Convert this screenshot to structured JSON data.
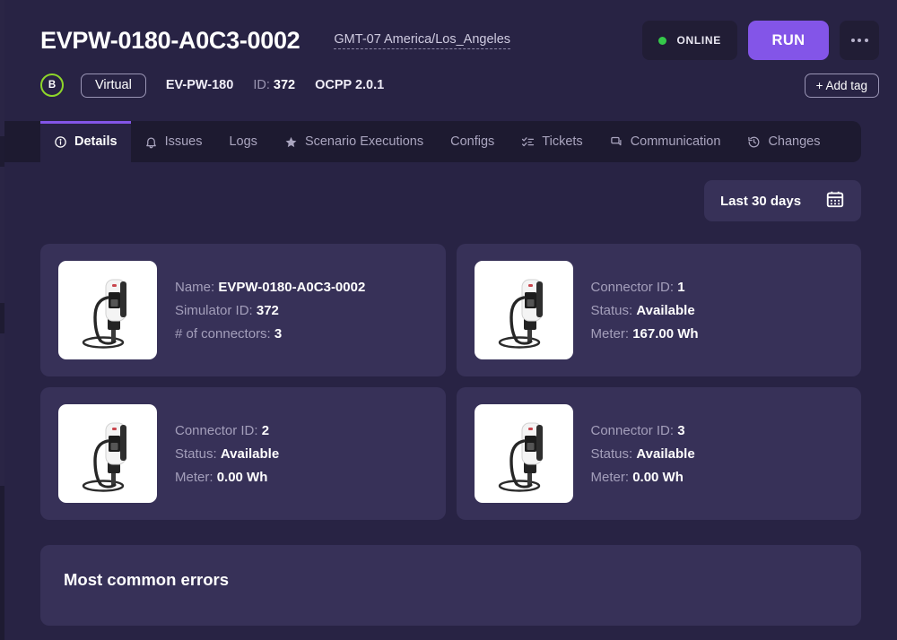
{
  "header": {
    "device_title": "EVPW-0180-A0C3-0002",
    "timezone": "GMT-07 America/Los_Angeles",
    "status_text": "ONLINE",
    "status_color": "#35c94a",
    "run_label": "RUN",
    "run_color": "#8355e8",
    "more_icon": "ellipsis-icon"
  },
  "meta": {
    "letter_badge": "B",
    "letter_badge_color": "#8ed62a",
    "virtual_label": "Virtual",
    "model": "EV-PW-180",
    "id_label": "ID:",
    "id_value": "372",
    "ocpp": "OCPP 2.0.1",
    "add_tag_label": "+ Add tag"
  },
  "tabs": [
    {
      "label": "Details",
      "icon": "info-circle-icon",
      "active": true
    },
    {
      "label": "Issues",
      "icon": "bell-icon",
      "active": false
    },
    {
      "label": "Logs",
      "icon": "",
      "active": false
    },
    {
      "label": "Scenario Executions",
      "icon": "star-icon",
      "active": false
    },
    {
      "label": "Configs",
      "icon": "",
      "active": false
    },
    {
      "label": "Tickets",
      "icon": "checklist-icon",
      "active": false
    },
    {
      "label": "Communication",
      "icon": "chat-icon",
      "active": false
    },
    {
      "label": "Changes",
      "icon": "history-clock-icon",
      "active": false
    }
  ],
  "range_picker": {
    "label": "Last 30 days",
    "icon": "calendar-icon"
  },
  "cards": [
    {
      "image": "ev-charger-photo",
      "lines": [
        {
          "label": "Name:",
          "value": "EVPW-0180-A0C3-0002"
        },
        {
          "label": "Simulator ID:",
          "value": "372"
        },
        {
          "label": "# of connectors:",
          "value": "3"
        }
      ]
    },
    {
      "image": "ev-charger-photo",
      "lines": [
        {
          "label": "Connector ID:",
          "value": "1"
        },
        {
          "label": "Status:",
          "value": "Available"
        },
        {
          "label": "Meter:",
          "value": "167.00 Wh"
        }
      ]
    },
    {
      "image": "ev-charger-photo",
      "lines": [
        {
          "label": "Connector ID:",
          "value": "2"
        },
        {
          "label": "Status:",
          "value": "Available"
        },
        {
          "label": "Meter:",
          "value": "0.00 Wh"
        }
      ]
    },
    {
      "image": "ev-charger-photo",
      "lines": [
        {
          "label": "Connector ID:",
          "value": "3"
        },
        {
          "label": "Status:",
          "value": "Available"
        },
        {
          "label": "Meter:",
          "value": "0.00 Wh"
        }
      ]
    }
  ],
  "errors_section": {
    "title": "Most common errors"
  }
}
